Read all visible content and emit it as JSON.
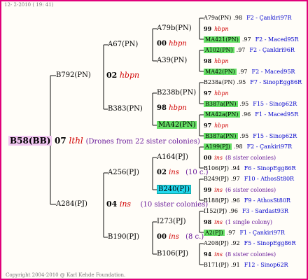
{
  "header": "12- 2-2010 ( 19: 41)",
  "footer": "Copyright 2004-2010 @ Karl Kehde Foundation.",
  "root": {
    "name": "B58(BB)",
    "year": "07",
    "type": "lthl",
    "note": "(Drones from 22 sister colonies)"
  },
  "gen1": [
    {
      "name": "B792(PN)"
    },
    {
      "name": "A284(PJ)",
      "year": "04",
      "type": "ins",
      "note": "(10 sister colonies)"
    }
  ],
  "gen1_top": {
    "year": "02",
    "type": "hbpn"
  },
  "gen2": [
    {
      "name": "A67(PN)"
    },
    {
      "name": "B383(PN)"
    },
    {
      "name": "A256(PJ)"
    },
    {
      "name": "B190(PJ)"
    }
  ],
  "gen3": [
    {
      "name": "A79b(PN)",
      "year": "00",
      "type": "hbpn"
    },
    {
      "name": "A39(PN)"
    },
    {
      "name": "B238b(PN)",
      "year": "98",
      "type": "hbpn"
    },
    {
      "name": "MA42(PN)"
    },
    {
      "name": "A164(PJ)",
      "year": "02",
      "type": "ins",
      "note": "(10 c.)"
    },
    {
      "name": "B240(PJ)"
    },
    {
      "name": "I273(PJ)",
      "year": "00",
      "type": "ins",
      "note": "(8 c.)"
    },
    {
      "name": "B106(PJ)"
    }
  ],
  "gen4": [
    {
      "name": "A79a(PN)",
      "num": ".98",
      "loc": "F2 - Çankiri97R"
    },
    {
      "year": "99",
      "type": "hbpn"
    },
    {
      "name": "MA421(PN)",
      "num": ".97",
      "loc": "F2 - Maced95R"
    },
    {
      "name": "A102(PN)",
      "num": ".97",
      "loc": "F2 - Çankiri96R"
    },
    {
      "year": "98",
      "type": "hbpn"
    },
    {
      "name": "MA42(PN)",
      "num": ".97",
      "loc": "F2 - Maced95R"
    },
    {
      "name": "B238a(PN)",
      "num": ".95",
      "loc": "F7 - SinopEgg86R"
    },
    {
      "year": "97",
      "type": "hbpn"
    },
    {
      "name": "B387a(PN)",
      "num": ".95",
      "loc": "F15 - Sinop62R"
    },
    {
      "name": "MA42a(PN)",
      "num": ".96",
      "loc": "F1 - Maced95R"
    },
    {
      "year": "97",
      "type": "hbpn"
    },
    {
      "name": "B387a(PN)",
      "num": ".95",
      "loc": "F15 - Sinop62R"
    },
    {
      "name": "A199(PJ)",
      "num": ".98",
      "loc": "F2 - Çankiri97R"
    },
    {
      "year": "00",
      "type": "ins",
      "note": "(8 sister colonies)"
    },
    {
      "name": "B106(PJ)",
      "num": ".94",
      "loc": "F6 - SinopEgg86R"
    },
    {
      "name": "B249(PJ)",
      "num": ".97",
      "loc": "F10 - AthosSt80R"
    },
    {
      "year": "99",
      "type": "ins",
      "note": "(6 sister colonies)"
    },
    {
      "name": "B188(PJ)",
      "num": ".96",
      "loc": "F9 - AthosSt80R"
    },
    {
      "name": "I152(PJ)",
      "num": ".96",
      "loc": "F3 - Sardast93R"
    },
    {
      "year": "98",
      "type": "ins",
      "note": "(1 single colony)"
    },
    {
      "name": "A2(PJ)",
      "num": ".97",
      "loc": "F1 - Çankiri97R"
    },
    {
      "name": "A208(PJ)",
      "num": ".92",
      "loc": "F5 - SinopEgg86R"
    },
    {
      "year": "94",
      "type": "ins",
      "note": "(8 sister colonies)"
    },
    {
      "name": "B171(PJ)",
      "num": ".91",
      "loc": "F12 - Sinop62R"
    }
  ]
}
